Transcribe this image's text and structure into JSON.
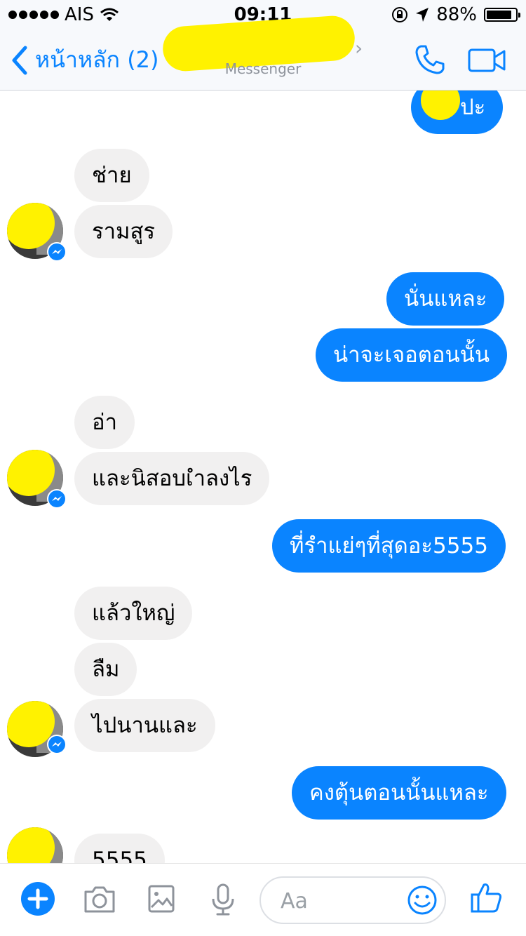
{
  "status": {
    "carrier": "AIS",
    "time": "09:11",
    "battery": "88%",
    "battery_level": 0.88
  },
  "nav": {
    "back_label": "หน้าหลัก (2)",
    "subtitle": "Messenger"
  },
  "messages": [
    {
      "side": "out",
      "text": "ปะ"
    },
    {
      "side": "in",
      "text": "ช่าย"
    },
    {
      "side": "in",
      "text": "รามสูร"
    },
    {
      "side": "out",
      "text": "นั่นแหละ"
    },
    {
      "side": "out",
      "text": "น่าจะเจอตอนนั้น"
    },
    {
      "side": "in",
      "text": "อ่า"
    },
    {
      "side": "in",
      "text": "และนิสอบเำลงไร"
    },
    {
      "side": "out",
      "text": "ที่รำแย่ๆที่สุดอะ5555"
    },
    {
      "side": "in",
      "text": "แล้วใหญ่"
    },
    {
      "side": "in",
      "text": "ลืม"
    },
    {
      "side": "in",
      "text": "ไปนานและ"
    },
    {
      "side": "out",
      "text": "คงตุ้นตอนนั้นแหละ"
    },
    {
      "side": "in",
      "text": "5555"
    }
  ],
  "composer": {
    "placeholder": "Aa"
  },
  "colors": {
    "accent": "#0a84ff",
    "bubble_in": "#f1f0f0",
    "redaction": "#fff200"
  }
}
